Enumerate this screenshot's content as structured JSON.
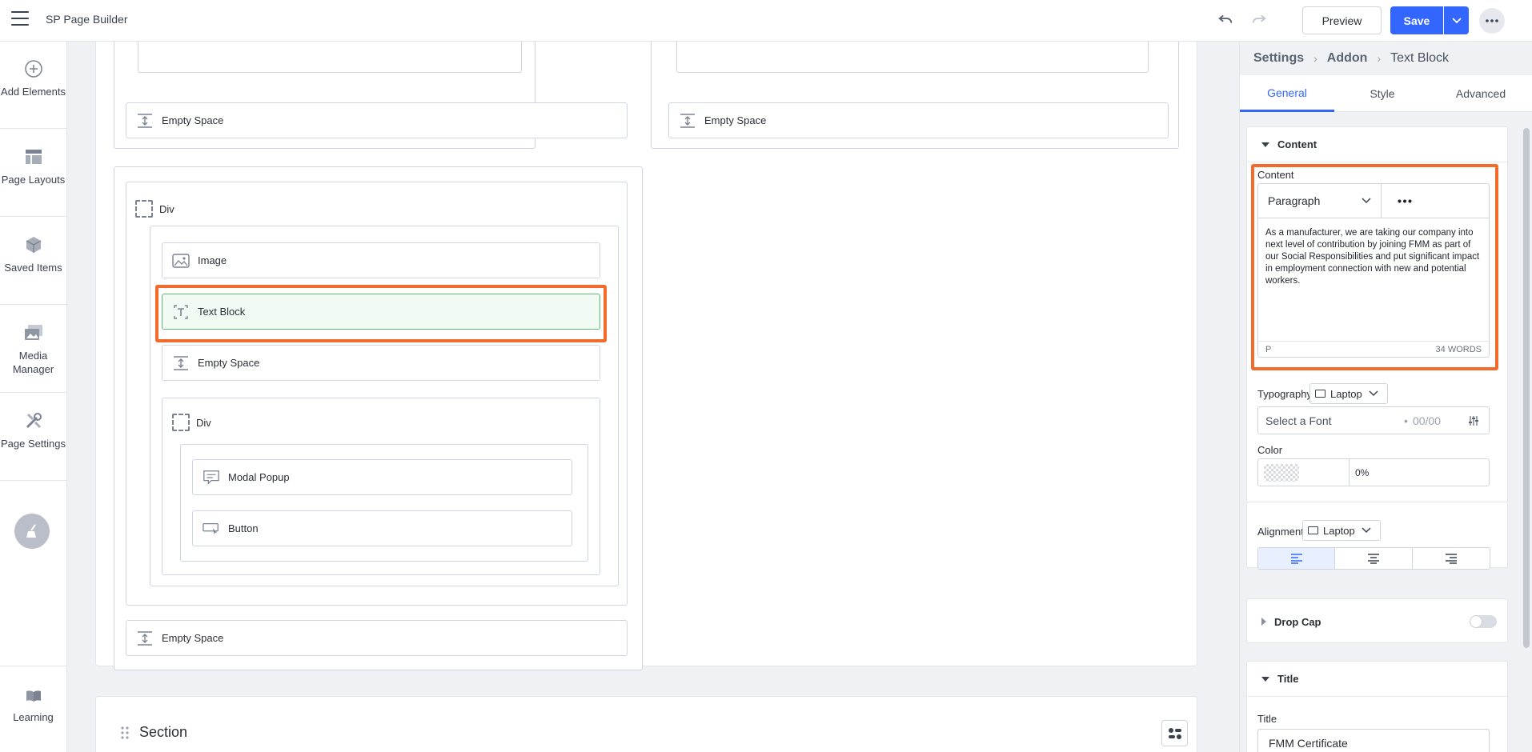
{
  "app": {
    "title": "SP Page Builder"
  },
  "header": {
    "preview_label": "Preview",
    "save_label": "Save"
  },
  "sidebar": {
    "items": [
      {
        "label": "Add Elements",
        "icon": "plus-circle-icon"
      },
      {
        "label": "Page Layouts",
        "icon": "layout-icon"
      },
      {
        "label": "Saved Items",
        "icon": "box-icon"
      },
      {
        "label": "Media Manager",
        "icon": "images-icon"
      },
      {
        "label": "Page Settings",
        "icon": "tools-icon"
      }
    ],
    "learning_label": "Learning"
  },
  "canvas": {
    "top_left_empty_space": "Empty Space",
    "top_right_empty_space": "Empty Space",
    "div_label": "Div",
    "image_label": "Image",
    "text_block_label": "Text Block",
    "empty_space_label": "Empty Space",
    "inner_div_label": "Div",
    "modal_popup_label": "Modal Popup",
    "button_label": "Button",
    "bottom_empty_space": "Empty Space",
    "section_title": "Section"
  },
  "panel": {
    "breadcrumb": [
      "Settings",
      "Addon",
      "Text Block"
    ],
    "tabs": [
      "General",
      "Style",
      "Advanced"
    ],
    "active_tab": "General",
    "content_section_title": "Content",
    "content_label": "Content",
    "format_value": "Paragraph",
    "editor_text": "As a manufacturer, we are taking our company into next level of contribution by joining FMM as part of our Social Responsibilities and put significant impact in employment connection with new and potential workers.",
    "editor_path": "P",
    "word_count": "34 WORDS",
    "typography_label": "Typography",
    "device_value": "Laptop",
    "font_placeholder": "Select a Font",
    "font_size_placeholder": "00/00",
    "color_label": "Color",
    "color_opacity": "0%",
    "alignment_label": "Alignment",
    "alignment_device": "Laptop",
    "drop_cap_label": "Drop Cap",
    "title_section_title": "Title",
    "title_label": "Title",
    "title_value": "FMM Certificate"
  },
  "colors": {
    "accent": "#3366ff",
    "highlight": "#f26b2a",
    "selected_bg": "#f1fbf3"
  }
}
